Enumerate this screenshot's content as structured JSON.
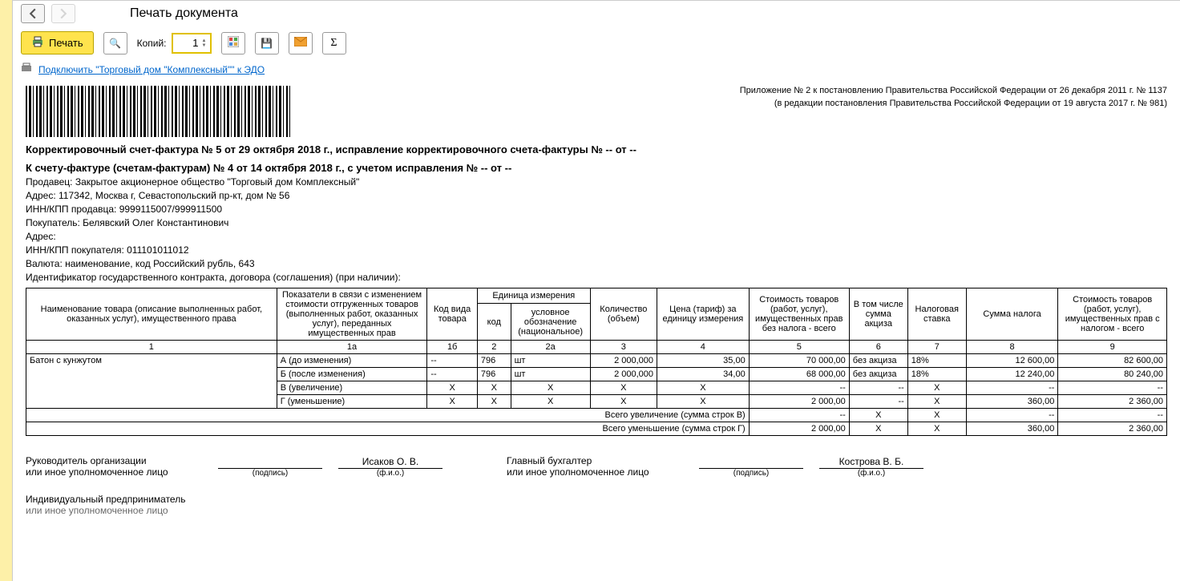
{
  "title": "Печать документа",
  "toolbar": {
    "print": "Печать",
    "copies_label": "Копий:",
    "copies_value": "1"
  },
  "edo_link": "Подключить \"Торговый дом \"Комплексный\"\" к ЭДО",
  "header_note1": "Приложение № 2 к постановлению Правительства Российской Федерации от 26 декабря 2011 г. № 1137",
  "header_note2": "(в редакции постановления Правительства Российской Федерации от 19 августа 2017 г. № 981)",
  "doc_title1": "Корректировочный счет-фактура № 5 от 29 октября 2018 г., исправление корректировочного счета-фактуры № -- от --",
  "doc_title2": "К счету-фактуре (счетам-фактурам) № 4 от 14 октября 2018 г., с учетом исправления № -- от --",
  "seller": "Продавец: Закрытое акционерное общество \"Торговый дом Комплексный\"",
  "seller_addr": "Адрес: 117342, Москва г, Севастопольский пр-кт, дом № 56",
  "seller_inn": "ИНН/КПП продавца: 9999115007/999911500",
  "buyer": "Покупатель: Белявский Олег Константинович",
  "buyer_addr": "Адрес:",
  "buyer_inn": "ИНН/КПП покупателя: 011101011012",
  "currency": "Валюта: наименование, код Российский рубль, 643",
  "contract_id": "Идентификатор государственного контракта, договора (соглашения) (при наличии):",
  "cols": {
    "c1": "Наименование товара (описание выполненных работ, оказанных услуг), имущественного права",
    "c1a": "Показатели в связи с изменением стоимости отгруженных товаров (выполненных работ, оказанных услуг), переданных имущественных прав",
    "c1b": "Код вида товара",
    "c_unit": "Единица измерения",
    "c2": "код",
    "c2a": "условное обозначение (национальное)",
    "c3": "Количество (объем)",
    "c4": "Цена (тариф) за единицу измерения",
    "c5": "Стоимость товаров (работ, услуг), имущественных прав без налога - всего",
    "c6": "В том числе сумма акциза",
    "c7": "Налоговая ставка",
    "c8": "Сумма налога",
    "c9": "Стоимость товаров (работ, услуг), имущественных прав с налогом - всего",
    "n1": "1",
    "n1a": "1а",
    "n1b": "1б",
    "n2": "2",
    "n2a": "2а",
    "n3": "3",
    "n4": "4",
    "n5": "5",
    "n6": "6",
    "n7": "7",
    "n8": "8",
    "n9": "9"
  },
  "item": "Батон с кунжутом",
  "rows": {
    "a": {
      "lbl": "А (до изменения)",
      "kv": "--",
      "code": "796",
      "unit": "шт",
      "qty": "2 000,000",
      "price": "35,00",
      "cost": "70 000,00",
      "excise": "без акциза",
      "rate": "18%",
      "tax": "12 600,00",
      "total": "82 600,00"
    },
    "b": {
      "lbl": "Б (после изменения)",
      "kv": "--",
      "code": "796",
      "unit": "шт",
      "qty": "2 000,000",
      "price": "34,00",
      "cost": "68 000,00",
      "excise": "без акциза",
      "rate": "18%",
      "tax": "12 240,00",
      "total": "80 240,00"
    },
    "v": {
      "lbl": "В (увеличение)",
      "x": "Х",
      "dash": "--"
    },
    "g": {
      "lbl": "Г (уменьшение)",
      "x": "Х",
      "dash": "--",
      "cost": "2 000,00",
      "tax": "360,00",
      "total": "2 360,00"
    }
  },
  "totals": {
    "inc_label": "Всего увеличение (сумма строк В)",
    "dec_label": "Всего уменьшение (сумма строк Г)",
    "inc": {
      "cost": "--",
      "excise": "Х",
      "rate": "Х",
      "tax": "--",
      "total": "--"
    },
    "dec": {
      "cost": "2 000,00",
      "excise": "Х",
      "rate": "Х",
      "tax": "360,00",
      "total": "2 360,00"
    }
  },
  "sigs": {
    "head_label": "Руководитель организации",
    "or_label": "или иное уполномоченное лицо",
    "head_name": "Исаков О. В.",
    "acc_label": "Главный бухгалтер",
    "acc_name": "Кострова В. Б.",
    "sig_cap": "(подпись)",
    "fio_cap": "(ф.и.о.)",
    "ip": "Индивидуальный предприниматель",
    "ip_or": "или иное уполномоченное лицо"
  }
}
